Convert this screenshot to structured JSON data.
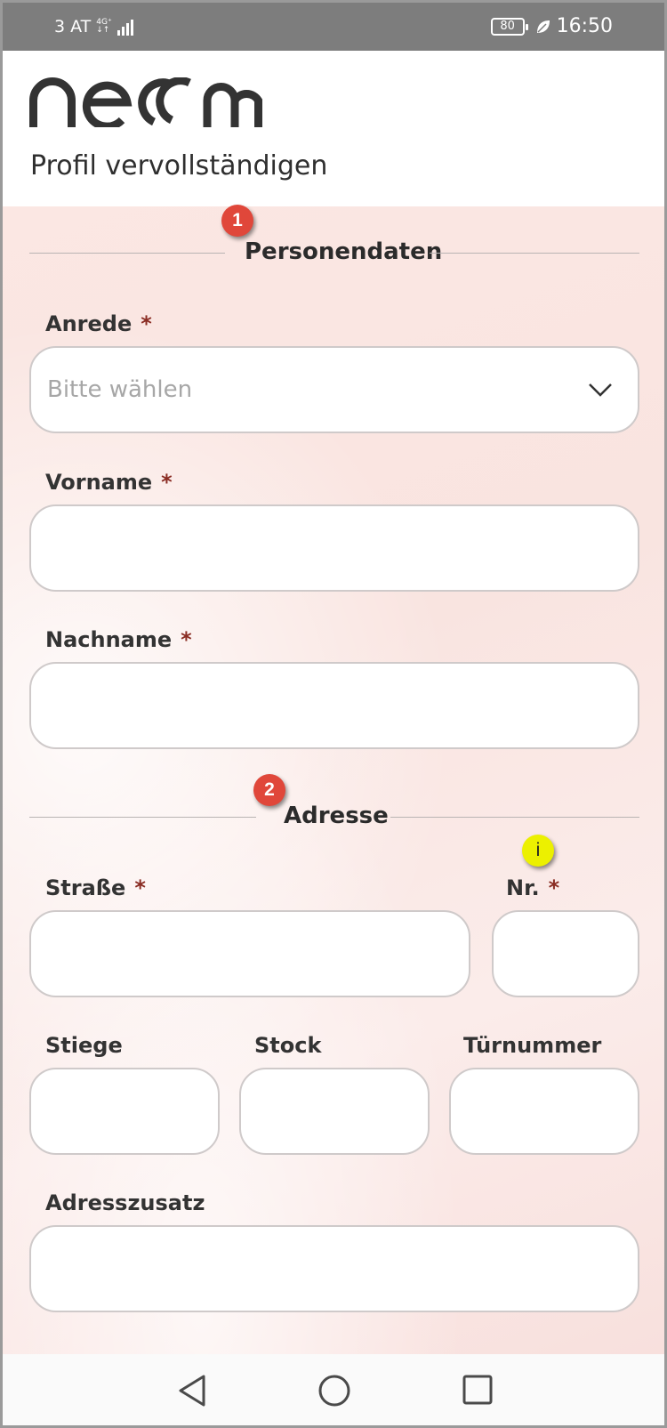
{
  "status_bar": {
    "carrier": "3 AT",
    "network": "4G⁺",
    "network_sub": "↓↑",
    "battery": "80",
    "time": "16:50"
  },
  "header": {
    "logo_text": "neoom",
    "title": "Profil vervollständigen"
  },
  "sections": {
    "personal": {
      "badge": "1",
      "heading": "Personendaten"
    },
    "address": {
      "badge": "2",
      "heading": "Adresse"
    }
  },
  "fields": {
    "anrede": {
      "label": "Anrede",
      "required": "*",
      "placeholder": "Bitte wählen"
    },
    "vorname": {
      "label": "Vorname",
      "required": "*",
      "value": ""
    },
    "nachname": {
      "label": "Nachname",
      "required": "*",
      "value": ""
    },
    "strasse": {
      "label": "Straße",
      "required": "*",
      "value": ""
    },
    "nr": {
      "label": "Nr.",
      "required": "*",
      "value": "",
      "info_badge": "i"
    },
    "stiege": {
      "label": "Stiege",
      "value": ""
    },
    "stock": {
      "label": "Stock",
      "value": ""
    },
    "tuernummer": {
      "label": "Türnummer",
      "value": ""
    },
    "adresszusatz": {
      "label": "Adresszusatz",
      "value": ""
    }
  },
  "nav_bar": {
    "back": "back-triangle-icon",
    "home": "home-circle-icon",
    "recents": "recents-square-icon"
  },
  "colors": {
    "status_bar": "#7d7d7d",
    "badge_red": "#e0473a",
    "badge_yellow": "#ecf000",
    "required_mark": "#8a2c23",
    "form_background": "#fbe7e3"
  }
}
